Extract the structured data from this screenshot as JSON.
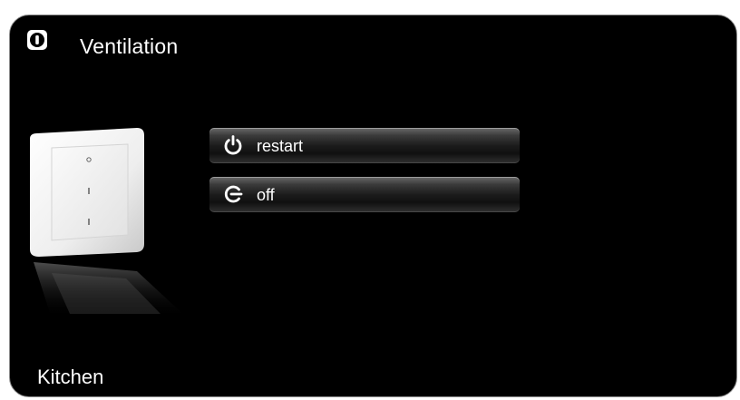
{
  "title": "Ventilation",
  "title_icon": "info-badge-icon",
  "device_image": "wall-switch-image",
  "buttons": [
    {
      "label": "restart",
      "icon": "power-icon"
    },
    {
      "label": "off",
      "icon": "power-off-g-icon"
    }
  ],
  "room": "Kitchen",
  "colors": {
    "background": "#000000",
    "text": "#ffffff",
    "border": "#8a8a8a"
  }
}
